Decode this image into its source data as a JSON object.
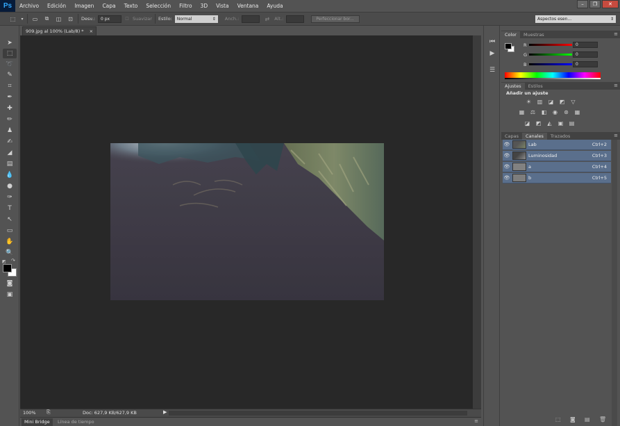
{
  "app": {
    "logo": "Ps"
  },
  "menu": [
    "Archivo",
    "Edición",
    "Imagen",
    "Capa",
    "Texto",
    "Selección",
    "Filtro",
    "3D",
    "Vista",
    "Ventana",
    "Ayuda"
  ],
  "options": {
    "feather_label": "Desv.:",
    "feather_value": "0 px",
    "smooth_label": "Suavizar",
    "style_label": "Estilo:",
    "style_value": "Normal",
    "width_label": "Anch.:",
    "height_label": "Alt.:",
    "refine_button": "Perfeccionar bor...",
    "workspace": "Aspectos esen..."
  },
  "document": {
    "tab_title": "909.jpg al 100% (Lab/8) *",
    "tab_close": "×"
  },
  "status": {
    "zoom": "100%",
    "doc_info": "Doc: 627,9 KB/627,9 KB"
  },
  "bottom_tabs": [
    "Mini Bridge",
    "Línea de tiempo"
  ],
  "color_panel": {
    "tabs": [
      "Color",
      "Muestras"
    ],
    "sliders": [
      {
        "label": "R",
        "value": "0"
      },
      {
        "label": "G",
        "value": "0"
      },
      {
        "label": "B",
        "value": "0"
      }
    ]
  },
  "adjust_panel": {
    "tabs": [
      "Ajustes",
      "Estilos"
    ],
    "title": "Añadir un ajuste"
  },
  "channels_panel": {
    "tabs": [
      "Capas",
      "Canales",
      "Trazados"
    ],
    "channels": [
      {
        "name": "Lab",
        "shortcut": "Ctrl+2"
      },
      {
        "name": "Luminosidad",
        "shortcut": "Ctrl+3"
      },
      {
        "name": "a",
        "shortcut": "Ctrl+4"
      },
      {
        "name": "b",
        "shortcut": "Ctrl+5"
      }
    ]
  },
  "colors": {
    "accent": "#31a8ff",
    "channel_row": "#5a6f8c",
    "canvas_bg": "#282828"
  }
}
